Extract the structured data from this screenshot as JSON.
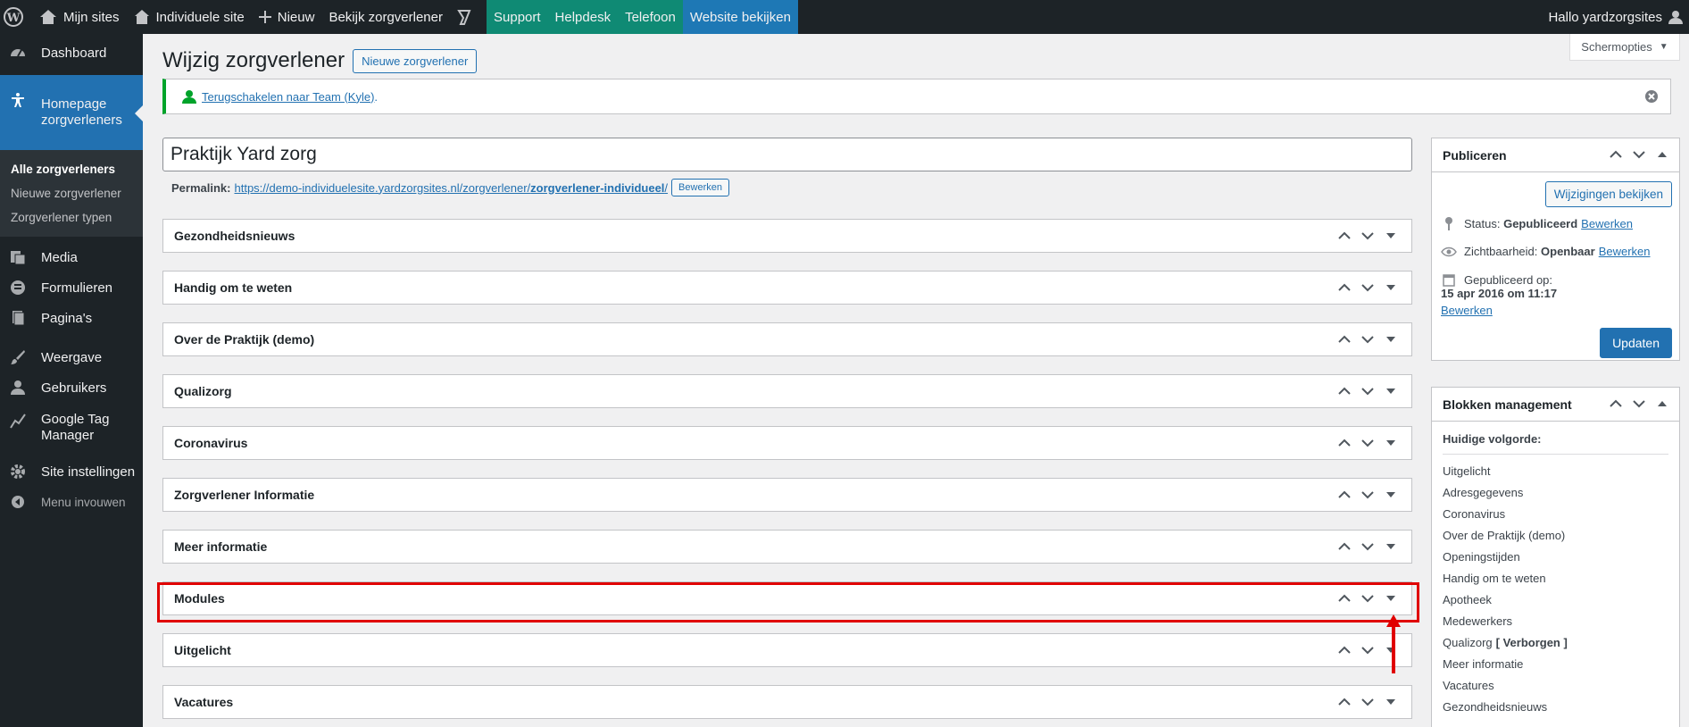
{
  "adminbar": {
    "my_sites": "Mijn sites",
    "site_name": "Individuele site",
    "new": "Nieuw",
    "view_provider": "Bekijk zorgverlener",
    "support": "Support",
    "helpdesk": "Helpdesk",
    "phone": "Telefoon",
    "view_site": "Website bekijken",
    "greeting": "Hallo yardzorgsites"
  },
  "sidebar": {
    "dashboard": "Dashboard",
    "current": "Homepage zorgverleners",
    "submenu": [
      "Alle zorgverleners",
      "Nieuwe zorgverlener",
      "Zorgverlener typen"
    ],
    "media": "Media",
    "forms": "Formulieren",
    "pages": "Pagina's",
    "appearance": "Weergave",
    "users": "Gebruikers",
    "gtm": "Google Tag Manager",
    "site_settings": "Site instellingen",
    "collapse": "Menu invouwen"
  },
  "header": {
    "title": "Wijzig zorgverlener",
    "new_button": "Nieuwe zorgverlener",
    "screen_options": "Schermopties"
  },
  "notice": {
    "link": "Terugschakelen naar Team (Kyle)",
    "suffix": "."
  },
  "post": {
    "title": "Praktijk Yard zorg",
    "permalink_label": "Permalink:",
    "permalink_base": "https://demo-individuelesite.yardzorgsites.nl/zorgverlener/",
    "permalink_slug": "zorgverlener-individueel",
    "permalink_end": "/",
    "edit_button": "Bewerken"
  },
  "metaboxes": [
    "Gezondheidsnieuws",
    "Handig om te weten",
    "Over de Praktijk (demo)",
    "Qualizorg",
    "Coronavirus",
    "Zorgverlener Informatie",
    "Meer informatie",
    "Modules",
    "Uitgelicht",
    "Vacatures"
  ],
  "publish": {
    "title": "Publiceren",
    "preview_button": "Wijzigingen bekijken",
    "status_label": "Status:",
    "status_value": "Gepubliceerd",
    "visibility_label": "Zichtbaarheid:",
    "visibility_value": "Openbaar",
    "published_label": "Gepubliceerd op:",
    "published_value": "15 apr 2016 om 11:17",
    "edit_link": "Bewerken",
    "update_button": "Updaten"
  },
  "blocks": {
    "title": "Blokken management",
    "subtitle": "Huidige volgorde:",
    "items": [
      "Uitgelicht",
      "Adresgegevens",
      "Coronavirus",
      "Over de Praktijk (demo)",
      "Openingstijden",
      "Handig om te weten",
      "Apotheek",
      "Medewerkers",
      "Qualizorg",
      "Meer informatie",
      "Vacatures",
      "Gezondheidsnieuws"
    ],
    "hidden_tag": "[ Verborgen ]"
  },
  "colors": {
    "accent": "#2271b1",
    "adminbar_green": "#0f8a74",
    "highlight": "#e00000"
  }
}
